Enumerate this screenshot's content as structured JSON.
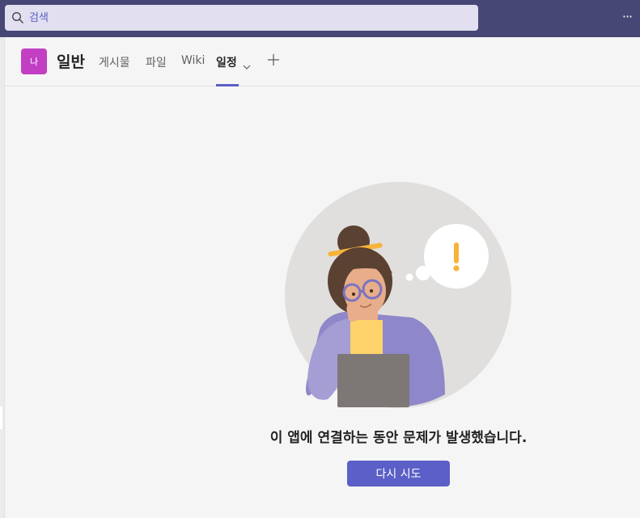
{
  "search": {
    "placeholder": "검색",
    "icon": "search-icon"
  },
  "topbar": {
    "more_label": "···",
    "background": "#464775"
  },
  "team": {
    "avatar_initial": "나",
    "avatar_color": "#c23fc3"
  },
  "channel": {
    "title": "일반",
    "tabs": [
      {
        "label": "게시물",
        "active": false
      },
      {
        "label": "파일",
        "active": false
      },
      {
        "label": "Wiki",
        "active": false
      },
      {
        "label": "일정",
        "active": true
      }
    ],
    "add_tab_icon": "plus-icon"
  },
  "error": {
    "message": "이 앱에 연결하는 동안 문제가 발생했습니다.",
    "retry_label": "다시 시도",
    "accent": "#5b5fc7"
  }
}
